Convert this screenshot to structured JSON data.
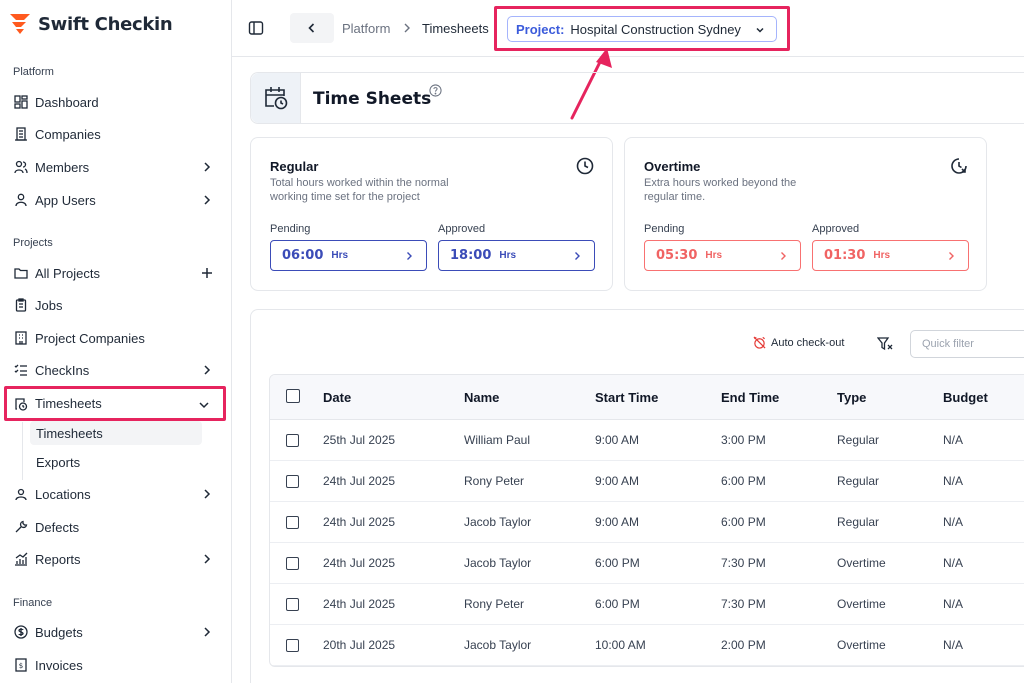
{
  "app": {
    "name": "Swift Checkin"
  },
  "sidebar": {
    "sections": [
      {
        "label": "Platform"
      },
      {
        "label": "Projects"
      },
      {
        "label": "Finance"
      }
    ],
    "items": [
      {
        "label": "Dashboard",
        "icon": "dashboard-icon"
      },
      {
        "label": "Companies",
        "icon": "building-icon"
      },
      {
        "label": "Members",
        "icon": "users-icon"
      },
      {
        "label": "App Users",
        "icon": "user-icon"
      },
      {
        "label": "All Projects",
        "icon": "folder-icon"
      },
      {
        "label": "Jobs",
        "icon": "clipboard-icon"
      },
      {
        "label": "Project Companies",
        "icon": "office-icon"
      },
      {
        "label": "CheckIns",
        "icon": "checklist-icon"
      },
      {
        "label": "Timesheets",
        "icon": "timesheet-icon"
      },
      {
        "label": "Locations",
        "icon": "location-icon"
      },
      {
        "label": "Defects",
        "icon": "wrench-icon"
      },
      {
        "label": "Reports",
        "icon": "chart-icon"
      },
      {
        "label": "Budgets",
        "icon": "dollar-icon"
      },
      {
        "label": "Invoices",
        "icon": "invoice-icon"
      }
    ],
    "subitems": [
      {
        "label": "Timesheets"
      },
      {
        "label": "Exports"
      }
    ]
  },
  "topbar": {
    "breadcrumbs": [
      "Platform",
      "Timesheets"
    ],
    "project_label": "Project:",
    "project_value": "Hospital Construction Sydney"
  },
  "page": {
    "title": "Time Sheets"
  },
  "cards": {
    "regular": {
      "title": "Regular",
      "desc": "Total hours worked within the normal working time set for the project",
      "pending_label": "Pending",
      "pending_value": "06:00",
      "approved_label": "Approved",
      "approved_value": "18:00",
      "unit": "Hrs"
    },
    "overtime": {
      "title": "Overtime",
      "desc": "Extra hours worked beyond the regular time.",
      "pending_label": "Pending",
      "pending_value": "05:30",
      "approved_label": "Approved",
      "approved_value": "01:30",
      "unit": "Hrs"
    }
  },
  "toolbar": {
    "auto_checkout": "Auto check-out",
    "quick_filter_placeholder": "Quick filter"
  },
  "table": {
    "columns": [
      "Date",
      "Name",
      "Start Time",
      "End Time",
      "Type",
      "Budget"
    ],
    "rows": [
      [
        "25th Jul 2025",
        "William Paul",
        "9:00 AM",
        "3:00 PM",
        "Regular",
        "N/A"
      ],
      [
        "24th Jul 2025",
        "Rony Peter",
        "9:00 AM",
        "6:00 PM",
        "Regular",
        "N/A"
      ],
      [
        "24th Jul 2025",
        "Jacob Taylor",
        "9:00 AM",
        "6:00 PM",
        "Regular",
        "N/A"
      ],
      [
        "24th Jul 2025",
        "Jacob Taylor",
        "6:00 PM",
        "7:30 PM",
        "Overtime",
        "N/A"
      ],
      [
        "24th Jul 2025",
        "Rony Peter",
        "6:00 PM",
        "7:30 PM",
        "Overtime",
        "N/A"
      ],
      [
        "20th Jul 2025",
        "Jacob Taylor",
        "10:00 AM",
        "2:00 PM",
        "Overtime",
        "N/A"
      ]
    ]
  },
  "colors": {
    "brand": "#ff5a1f",
    "highlight": "#e6245e",
    "accent_blue": "#3b4cb8",
    "overtime_red": "#f06363"
  }
}
